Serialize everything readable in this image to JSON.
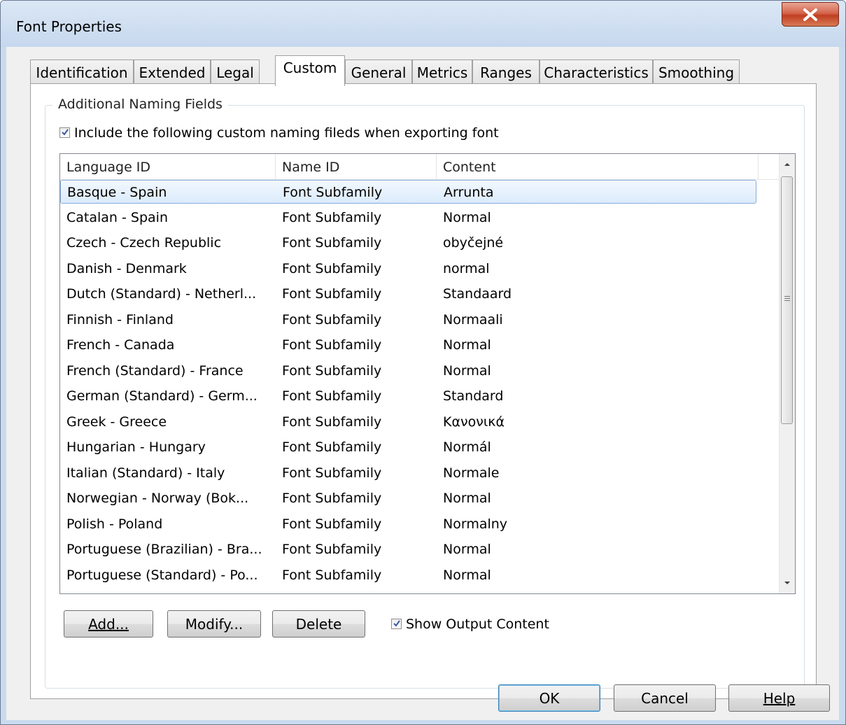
{
  "window": {
    "title": "Font Properties"
  },
  "tabs": [
    {
      "label": "Identification"
    },
    {
      "label": "Extended"
    },
    {
      "label": "Legal"
    },
    {
      "label": "Custom",
      "active": true
    },
    {
      "label": "General"
    },
    {
      "label": "Metrics"
    },
    {
      "label": "Ranges"
    },
    {
      "label": "Characteristics"
    },
    {
      "label": "Smoothing"
    }
  ],
  "group": {
    "legend": "Additional Naming Fields",
    "include_label": "Include the following custom naming fileds when exporting font",
    "include_checked": true
  },
  "table": {
    "columns": [
      "Language ID",
      "Name ID",
      "Content"
    ],
    "rows": [
      [
        "Basque - Spain",
        "Font Subfamily",
        "Arrunta"
      ],
      [
        "Catalan - Spain",
        "Font Subfamily",
        "Normal"
      ],
      [
        "Czech - Czech Republic",
        "Font Subfamily",
        "obyčejné"
      ],
      [
        "Danish - Denmark",
        "Font Subfamily",
        "normal"
      ],
      [
        "Dutch (Standard) - Netherl...",
        "Font Subfamily",
        "Standaard"
      ],
      [
        "Finnish - Finland",
        "Font Subfamily",
        "Normaali"
      ],
      [
        "French - Canada",
        "Font Subfamily",
        "Normal"
      ],
      [
        "French (Standard) - France",
        "Font Subfamily",
        "Normal"
      ],
      [
        "German (Standard) - Germ...",
        "Font Subfamily",
        "Standard"
      ],
      [
        "Greek - Greece",
        "Font Subfamily",
        "Κανονικά"
      ],
      [
        "Hungarian - Hungary",
        "Font Subfamily",
        "Normál"
      ],
      [
        "Italian (Standard) - Italy",
        "Font Subfamily",
        "Normale"
      ],
      [
        "Norwegian - Norway (Bok...",
        "Font Subfamily",
        "Normal"
      ],
      [
        "Polish - Poland",
        "Font Subfamily",
        "Normalny"
      ],
      [
        "Portuguese (Brazilian) - Bra...",
        "Font Subfamily",
        "Normal"
      ],
      [
        "Portuguese (Standard) - Po...",
        "Font Subfamily",
        "Normal"
      ]
    ],
    "selected_index": 0
  },
  "actions": {
    "add_label": "Add...",
    "modify_label": "Modify...",
    "delete_label": "Delete",
    "show_output_label": "Show Output Content",
    "show_output_checked": true
  },
  "footer": {
    "ok_label": "OK",
    "cancel_label": "Cancel",
    "help_label": "Help"
  },
  "colors": {
    "selection_border": "#84acdd",
    "close_button": "#c03f22",
    "default_button_border": "#3c7fb1"
  }
}
